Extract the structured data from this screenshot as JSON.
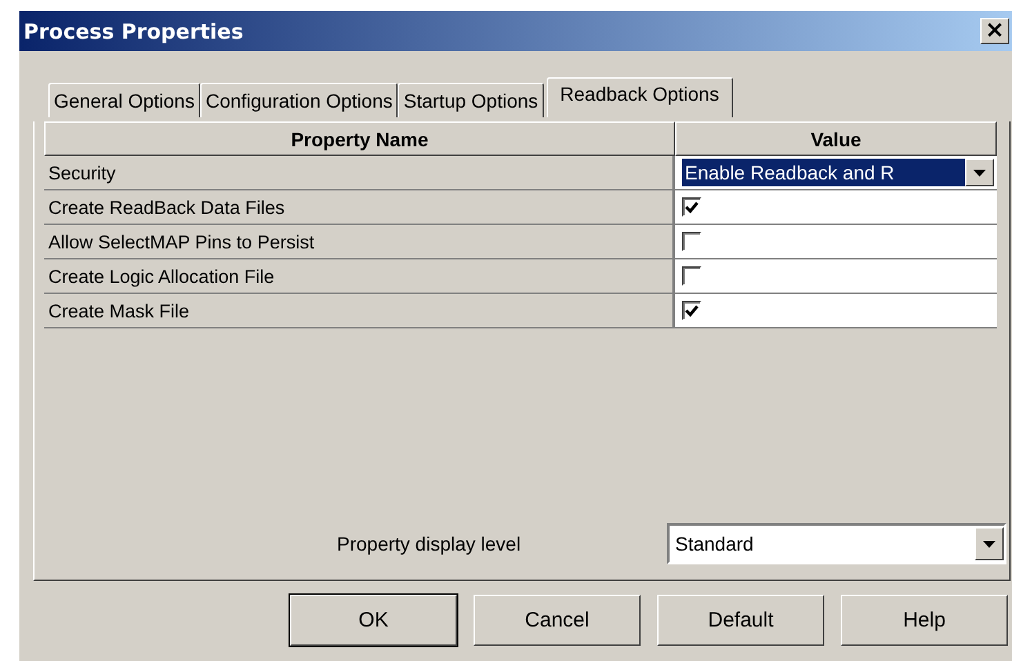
{
  "window": {
    "title": "Process Properties",
    "close": "×"
  },
  "tabs": [
    {
      "label": "General Options",
      "selected": false
    },
    {
      "label": "Configuration Options",
      "selected": false
    },
    {
      "label": "Startup Options",
      "selected": false
    },
    {
      "label": "Readback Options",
      "selected": true
    }
  ],
  "table": {
    "columns": [
      "Property Name",
      "Value"
    ],
    "rows": [
      {
        "name": "Security",
        "kind": "dropdown",
        "value": "Enable Readback and R",
        "selected": true
      },
      {
        "name": "Create ReadBack Data Files",
        "kind": "checkbox",
        "checked": true
      },
      {
        "name": "Allow SelectMAP Pins to Persist",
        "kind": "checkbox",
        "checked": false
      },
      {
        "name": "Create Logic Allocation File",
        "kind": "checkbox",
        "checked": false
      },
      {
        "name": "Create Mask File",
        "kind": "checkbox",
        "checked": true
      }
    ]
  },
  "display_level": {
    "label": "Property display level",
    "value": "Standard"
  },
  "buttons": [
    {
      "label": "OK",
      "default": true
    },
    {
      "label": "Cancel",
      "default": false
    },
    {
      "label": "Default",
      "default": false
    },
    {
      "label": "Help",
      "default": false
    }
  ]
}
